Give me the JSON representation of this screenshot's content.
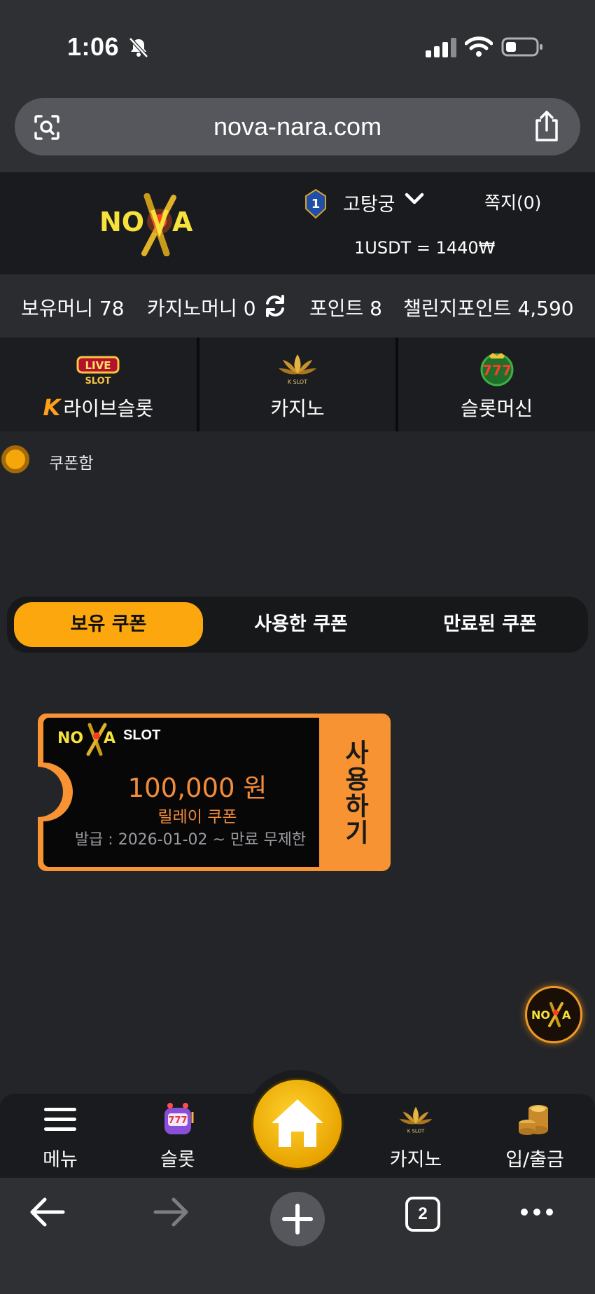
{
  "status_bar": {
    "time": "1:06"
  },
  "browser": {
    "url": "nova-nara.com",
    "tab_count": "2"
  },
  "header": {
    "username": "고탕궁",
    "level": "1",
    "messages_label": "쪽지(0)",
    "exchange_rate": "1USDT = 1440₩"
  },
  "balances": {
    "money": "보유머니 78",
    "casino_money": "카지노머니 0",
    "points": "포인트 8",
    "challenge_points": "챌린지포인트 4,590"
  },
  "game_nav": [
    {
      "label": "라이브슬롯",
      "icon": "live-slot-icon"
    },
    {
      "label": "카지노",
      "icon": "casino-lotus-icon"
    },
    {
      "label": "슬롯머신",
      "icon": "slot-777-icon"
    }
  ],
  "section": {
    "title": "쿠폰함"
  },
  "tabs": [
    {
      "label": "보유 쿠폰",
      "active": true
    },
    {
      "label": "사용한 쿠폰",
      "active": false
    },
    {
      "label": "만료된 쿠폰",
      "active": false
    }
  ],
  "coupon": {
    "brand": "SLOT",
    "amount": "100,000 원",
    "type": "릴레이 쿠폰",
    "dates": "발급 : 2026-01-02 ~ 만료 무제한",
    "use_label": "사용하기"
  },
  "bottom_nav": {
    "menu": "메뉴",
    "slot": "슬롯",
    "casino": "카지노",
    "bank": "입/출금"
  },
  "colors": {
    "accent": "#fca70d",
    "coupon_orange": "#f79332",
    "background": "#242528"
  }
}
